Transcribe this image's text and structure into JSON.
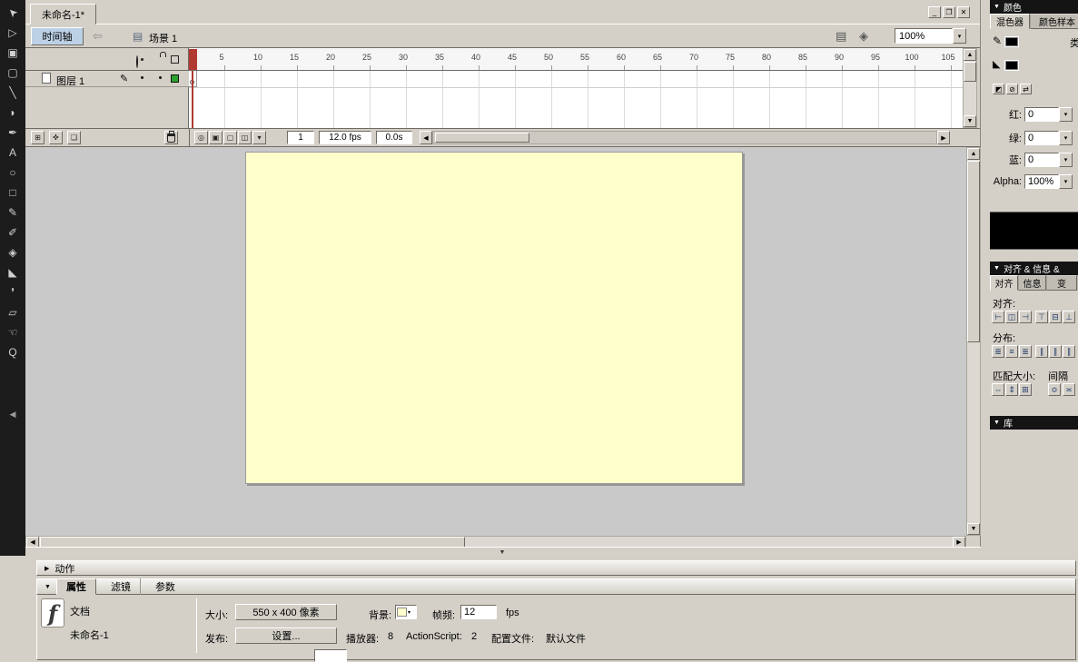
{
  "colors": {
    "stage": "#FFFFCC",
    "chrome": "#D4D0C8",
    "work_area": "#C9C9C9",
    "playhead": "#B03A30",
    "dark_header": "#141414",
    "timeline_toggle_bg": "#BDD1E6",
    "layer_outline": "#2EA02E",
    "preview": "#000000"
  },
  "window": {
    "doc_tab": "未命名-1*",
    "minimize": "_",
    "maximize": "❐",
    "close": "✕"
  },
  "edit_bar": {
    "timeline_toggle": "时间轴",
    "back_icon": "⇦",
    "scene_icon": "▤",
    "scene_name": "场景 1",
    "edit_scene_icon": "▤",
    "edit_symbol_icon": "◈",
    "zoom_value": "100%",
    "zoom_dropdown": "▾"
  },
  "tools": [
    {
      "name": "selection",
      "glyph": "➤"
    },
    {
      "name": "subselection",
      "glyph": "▷"
    },
    {
      "name": "free-transform",
      "glyph": "▣"
    },
    {
      "name": "gradient-transform",
      "glyph": "▢"
    },
    {
      "name": "line",
      "glyph": "╲"
    },
    {
      "name": "lasso",
      "glyph": "◗"
    },
    {
      "name": "pen",
      "glyph": "✒"
    },
    {
      "name": "text",
      "glyph": "A"
    },
    {
      "name": "oval",
      "glyph": "○"
    },
    {
      "name": "rectangle",
      "glyph": "□"
    },
    {
      "name": "pencil",
      "glyph": "✎"
    },
    {
      "name": "brush",
      "glyph": "✐"
    },
    {
      "name": "ink-bottle",
      "glyph": "◈"
    },
    {
      "name": "paint-bucket",
      "glyph": "◣"
    },
    {
      "name": "eyedropper",
      "glyph": "❜"
    },
    {
      "name": "eraser",
      "glyph": "▱"
    },
    {
      "name": "hand",
      "glyph": "☜"
    },
    {
      "name": "zoom",
      "glyph": "Q"
    }
  ],
  "timeline": {
    "ruler": [
      "5",
      "10",
      "15",
      "20",
      "25",
      "30",
      "35",
      "40",
      "45",
      "50",
      "55",
      "60",
      "65",
      "70",
      "75",
      "80",
      "85",
      "90",
      "95",
      "100",
      "105"
    ],
    "layer_name": "图层 1",
    "active_pencil": "✎",
    "visible_dot": "•",
    "lock_dot": "•",
    "onion_buttons": [
      {
        "name": "center-frame",
        "glyph": "◎"
      },
      {
        "name": "onion-skin",
        "glyph": "▣"
      },
      {
        "name": "onion-skin-outlines",
        "glyph": "▢"
      },
      {
        "name": "edit-multiple-frames",
        "glyph": "◫"
      },
      {
        "name": "modify-onion-markers",
        "glyph": "▾"
      }
    ],
    "layer_buttons": [
      {
        "name": "insert-layer",
        "glyph": "⊞"
      },
      {
        "name": "add-motion-guide",
        "glyph": "✜"
      },
      {
        "name": "insert-layer-folder",
        "glyph": "❏"
      }
    ],
    "footer": {
      "current_frame": "1",
      "frame_rate": "12.0 fps",
      "elapsed": "0.0s"
    }
  },
  "color_panel": {
    "title": "颜色",
    "tab_mixer": "混色器",
    "tab_swatches": "颜色样本",
    "type_label": "类",
    "stroke_icon": "✎",
    "fill_icon": "◣",
    "default_colors_icon": "◩",
    "no_color_icon": "⊘",
    "swap_colors_icon": "⇄",
    "rgb": [
      {
        "label": "红:",
        "value": "0"
      },
      {
        "label": "绿:",
        "value": "0"
      },
      {
        "label": "蓝:",
        "value": "0"
      },
      {
        "label": "Alpha:",
        "value": "100%"
      }
    ]
  },
  "align_panel": {
    "title": "对齐 & 信息 &",
    "tab_align": "对齐",
    "tab_info": "信息",
    "tab_transform": "变",
    "align_label": "对齐:",
    "distribute_label": "分布:",
    "match_label": "匹配大小:",
    "spacing_label": "间隔",
    "align_buttons": [
      {
        "name": "align-left",
        "glyph": "⊢"
      },
      {
        "name": "align-center-h",
        "glyph": "◫"
      },
      {
        "name": "align-right",
        "glyph": "⊣"
      },
      {
        "name": "align-top",
        "glyph": "⊤"
      },
      {
        "name": "align-center-v",
        "glyph": "⊟"
      },
      {
        "name": "align-bottom",
        "glyph": "⊥"
      }
    ],
    "distribute_buttons": [
      {
        "name": "distribute-top",
        "glyph": "≣"
      },
      {
        "name": "distribute-center-v",
        "glyph": "≡"
      },
      {
        "name": "distribute-bottom",
        "glyph": "≣"
      },
      {
        "name": "distribute-left",
        "glyph": "∥"
      },
      {
        "name": "distribute-center-h",
        "glyph": "∥"
      },
      {
        "name": "distribute-right",
        "glyph": "∥"
      }
    ],
    "match_buttons": [
      {
        "name": "match-width",
        "glyph": "⇔"
      },
      {
        "name": "match-height",
        "glyph": "⇕"
      },
      {
        "name": "match-both",
        "glyph": "⊞"
      }
    ],
    "spacing_buttons": [
      {
        "name": "space-even-v",
        "glyph": "≎"
      },
      {
        "name": "space-even-h",
        "glyph": "≍"
      }
    ]
  },
  "library_panel": {
    "title": "库"
  },
  "actions_panel": {
    "title": "动作"
  },
  "properties": {
    "tab_properties": "属性",
    "tab_filters": "滤镜",
    "tab_parameters": "参数",
    "doc_type": "文档",
    "doc_name": "未命名-1",
    "logo_glyph": "f",
    "size_label": "大小:",
    "size_button": "550 x 400 像素",
    "publish_label": "发布:",
    "publish_button": "设置...",
    "background_label": "背景:",
    "framerate_label": "帧频:",
    "framerate_value": "12",
    "fps_unit": "fps",
    "player_label": "播放器:",
    "player_value": "8",
    "actionscript_label": "ActionScript:",
    "actionscript_value": "2",
    "profile_label": "配置文件:",
    "profile_value": "默认文件"
  },
  "ui": {
    "arrow_up": "▲",
    "arrow_down": "▼",
    "arrow_left": "◀",
    "arrow_right": "▶",
    "dropdown": "▾",
    "collapse_left": "◀",
    "panel_collapsed": "▶",
    "panel_expanded": "▼"
  }
}
